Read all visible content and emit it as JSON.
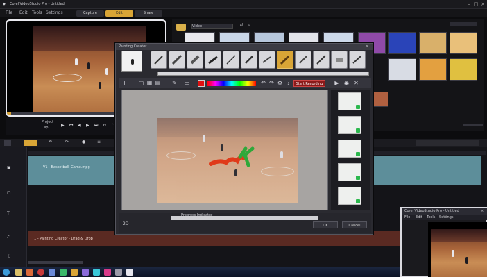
{
  "app": {
    "title": "Corel VideoStudio Pro - Untitled",
    "menu": [
      "File",
      "Edit",
      "Tools",
      "Settings"
    ],
    "steps": [
      "Capture",
      "Edit",
      "Share"
    ],
    "window_controls": [
      "minimize-icon",
      "maximize-icon",
      "close-icon"
    ]
  },
  "preview": {
    "mode_labels": [
      "Project",
      "Clip"
    ]
  },
  "library": {
    "folder": "Video"
  },
  "painting_dialog": {
    "title": "Painting Creator",
    "record_label": "Start Recording",
    "colour_hex": "#e01010",
    "progress_label": "Progress Indicator",
    "ok_label": "OK",
    "cancel_label": "Cancel"
  },
  "timeline": {
    "video_clip_label": "V1 - Basketball_Game.mpg",
    "title_clip_label": "T1 - Painting Creator - Drag & Drop"
  },
  "win2": {
    "title": "Corel VideoStudio Pro - Untitled",
    "menu": [
      "File",
      "Edit",
      "Tools",
      "Settings"
    ]
  }
}
